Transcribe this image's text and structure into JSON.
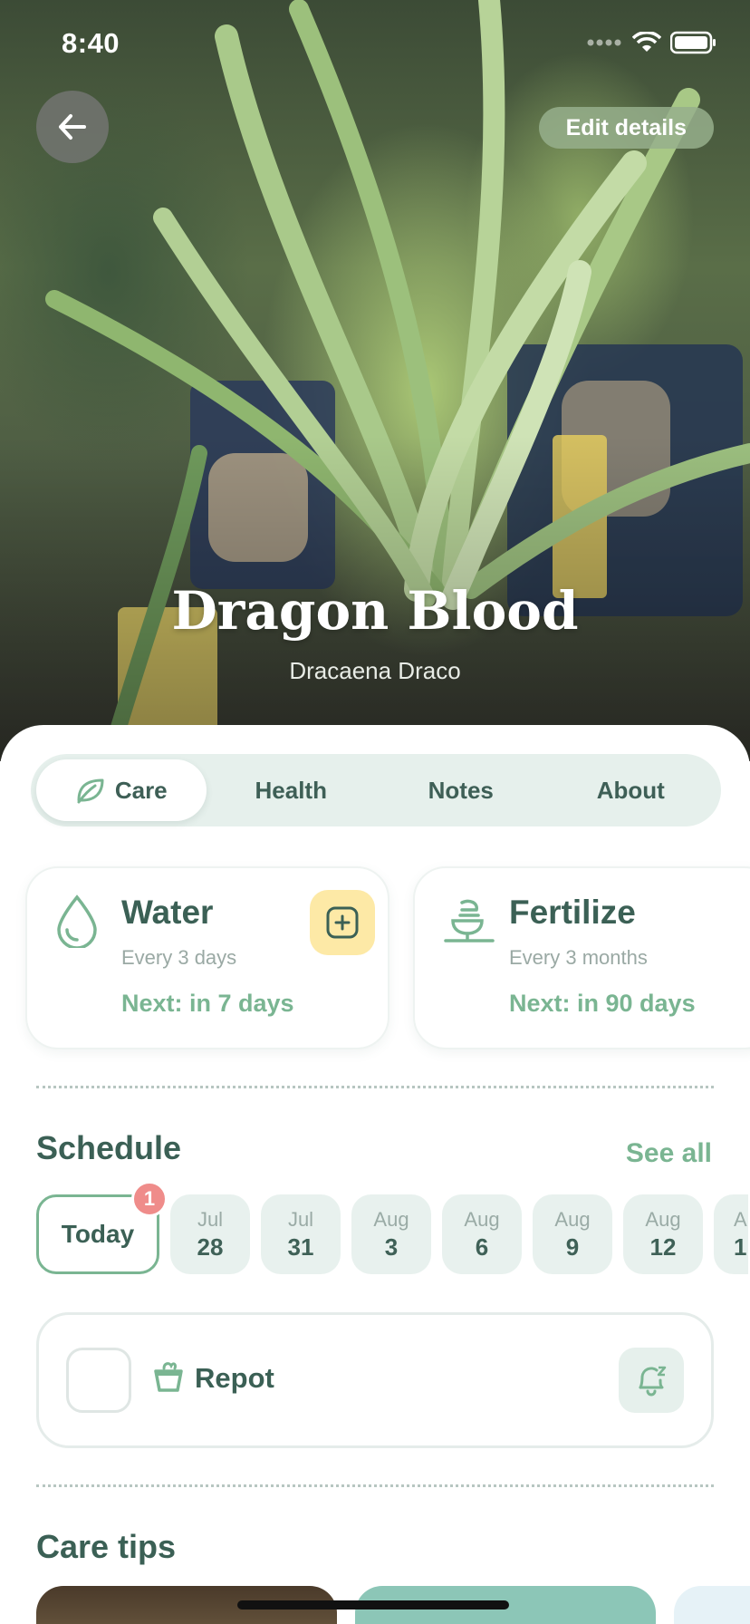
{
  "status": {
    "time": "8:40"
  },
  "header": {
    "edit_label": "Edit details"
  },
  "plant": {
    "name": "Dragon Blood",
    "scientific": "Dracaena Draco"
  },
  "tabs": [
    {
      "label": "Care",
      "active": true
    },
    {
      "label": "Health",
      "active": false
    },
    {
      "label": "Notes",
      "active": false
    },
    {
      "label": "About",
      "active": false
    }
  ],
  "care": [
    {
      "title": "Water",
      "frequency": "Every 3 days",
      "next": "Next: in 7 days",
      "icon": "water-drop-icon"
    },
    {
      "title": "Fertilize",
      "frequency": "Every 3 months",
      "next": "Next: in 90 days",
      "icon": "fertilize-icon"
    }
  ],
  "schedule": {
    "title": "Schedule",
    "see_all": "See all",
    "today_label": "Today",
    "today_badge": "1",
    "dates": [
      {
        "month": "Jul",
        "day": "28"
      },
      {
        "month": "Jul",
        "day": "31"
      },
      {
        "month": "Aug",
        "day": "3"
      },
      {
        "month": "Aug",
        "day": "6"
      },
      {
        "month": "Aug",
        "day": "9"
      },
      {
        "month": "Aug",
        "day": "12"
      },
      {
        "month": "Au",
        "day": "1"
      }
    ]
  },
  "task": {
    "label": "Repot",
    "icon": "pot-icon"
  },
  "tips": {
    "title": "Care tips"
  },
  "colors": {
    "accent": "#7ab592",
    "primary_text": "#3b6055",
    "badge": "#ef8c8a",
    "add_button": "#fde9a6"
  }
}
